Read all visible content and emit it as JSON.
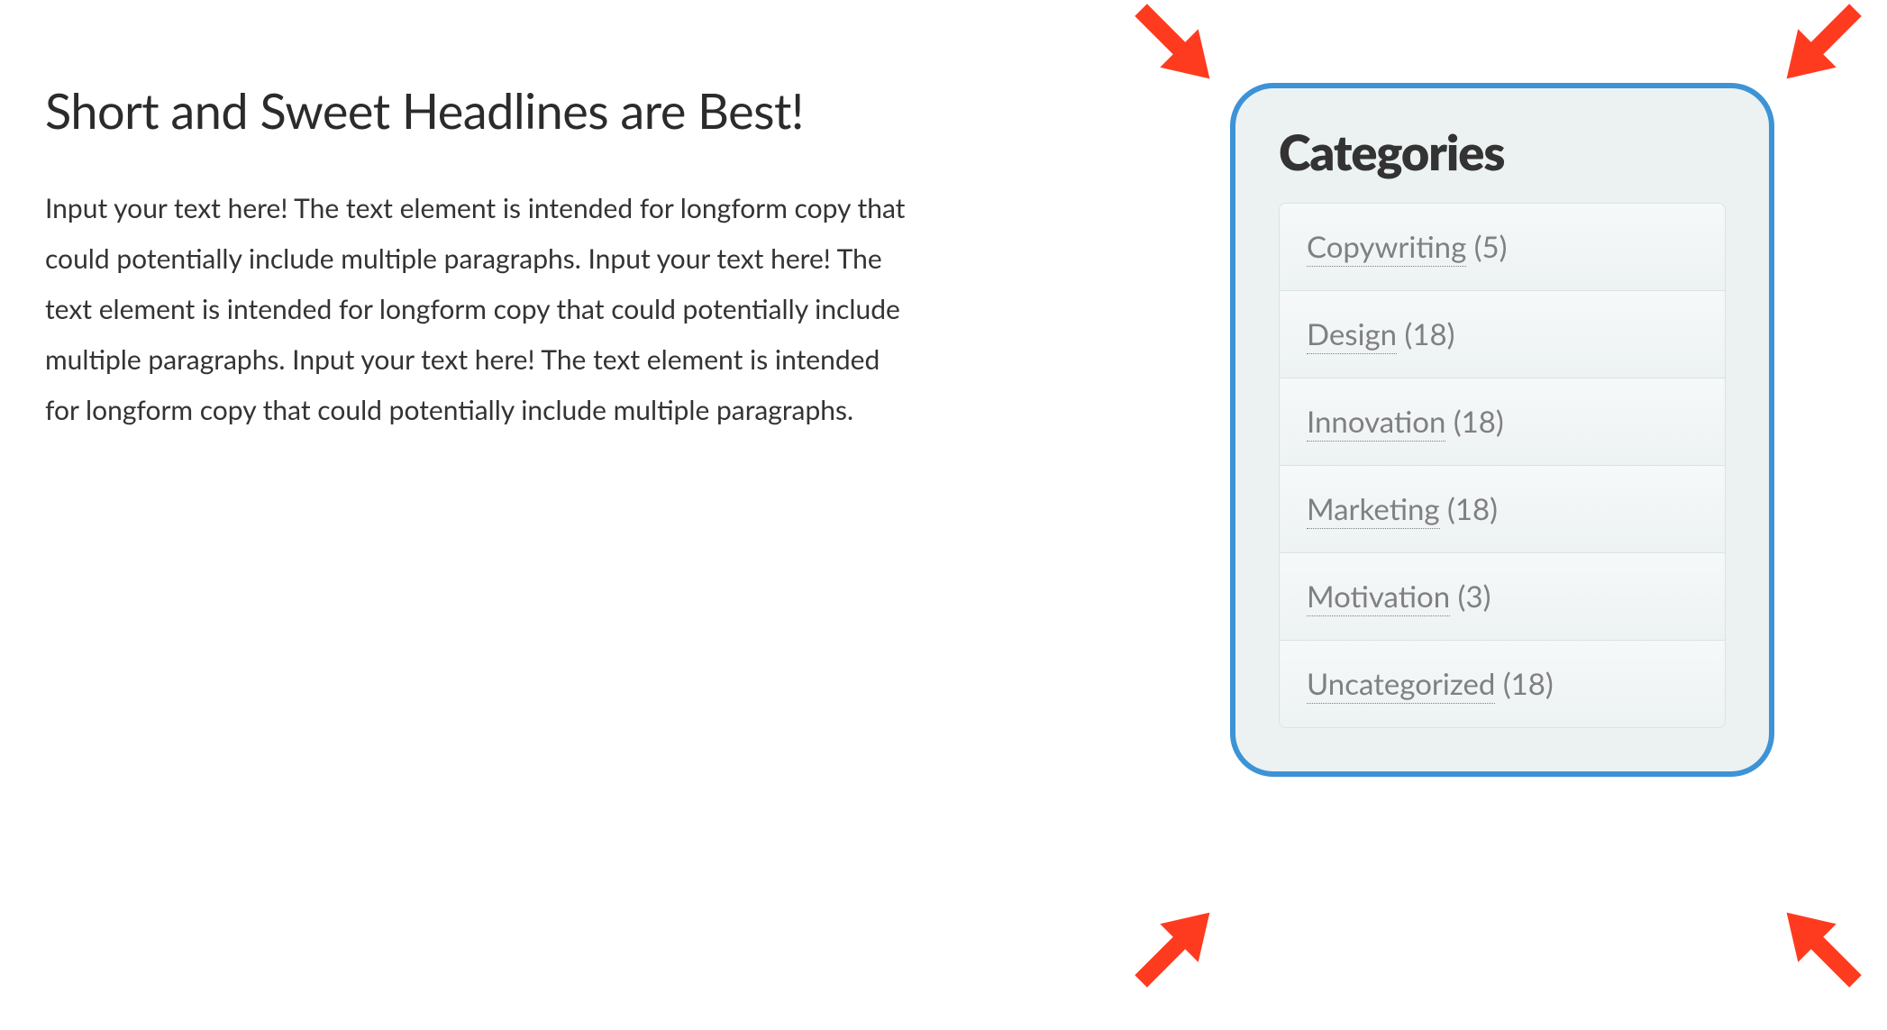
{
  "main": {
    "headline": "Short and Sweet Headlines are Best!",
    "body": "Input your text here! The text element is intended for longform copy that could potentially include multiple paragraphs. Input your text here! The text element is intended for longform copy that could potentially include multiple paragraphs. Input your text here! The text element is intended for longform copy that could potentially include multiple paragraphs."
  },
  "sidebar": {
    "title": "Categories",
    "items": [
      {
        "name": "Copywriting",
        "count": "(5)"
      },
      {
        "name": "Design",
        "count": "(18)"
      },
      {
        "name": "Innovation",
        "count": "(18)"
      },
      {
        "name": "Marketing",
        "count": "(18)"
      },
      {
        "name": "Motivation",
        "count": "(3)"
      },
      {
        "name": "Uncategorized",
        "count": "(18)"
      }
    ]
  },
  "annotations": {
    "arrow_color": "#ff3b1f"
  }
}
